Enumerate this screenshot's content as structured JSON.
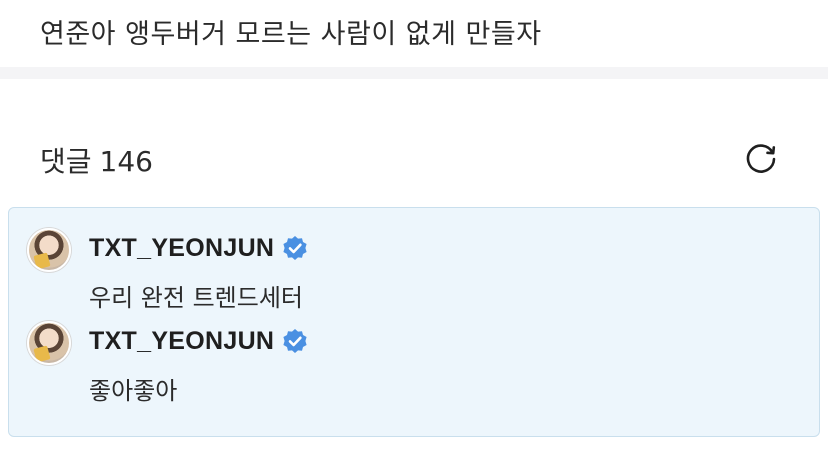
{
  "post": {
    "text": "연준아 앵두버거 모르는 사람이 없게 만들자"
  },
  "comments_header": {
    "label": "댓글",
    "count": "146",
    "refresh_icon": "refresh-icon"
  },
  "comments": [
    {
      "username": "TXT_YEONJUN",
      "verified_icon": "verified-badge-icon",
      "text": "우리 완전 트렌드세터"
    },
    {
      "username": "TXT_YEONJUN",
      "verified_icon": "verified-badge-icon",
      "text": "좋아좋아"
    }
  ],
  "colors": {
    "highlight_bg": "#edf6fc",
    "highlight_border": "#c9dfed",
    "verified_blue": "#4a90e2",
    "divider": "#f4f4f6"
  }
}
